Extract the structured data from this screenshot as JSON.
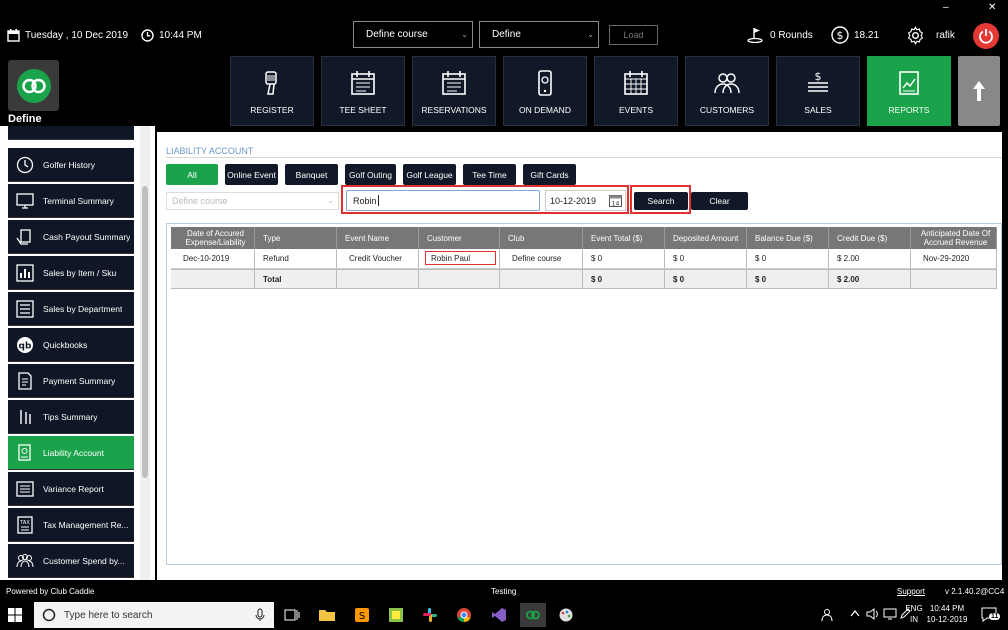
{
  "topbar": {
    "date": "Tuesday ,  10 Dec 2019",
    "time": "10:44 PM",
    "course_select": "Define  course",
    "define_select": "Define",
    "load_label": "Load",
    "rounds": "0 Rounds",
    "balance": "18.21",
    "user": "rafik",
    "minimize": "–",
    "close": "✕"
  },
  "brand": {
    "name": "Define"
  },
  "nav": [
    {
      "label": "REGISTER",
      "icon": "barcode-scanner-icon"
    },
    {
      "label": "TEE SHEET",
      "icon": "calendar-icon"
    },
    {
      "label": "RESERVATIONS",
      "icon": "calendar-icon"
    },
    {
      "label": "ON DEMAND",
      "icon": "mobile-icon"
    },
    {
      "label": "EVENTS",
      "icon": "calendar-grid-icon"
    },
    {
      "label": "CUSTOMERS",
      "icon": "users-icon"
    },
    {
      "label": "SALES",
      "icon": "money-icon"
    },
    {
      "label": "REPORTS",
      "icon": "report-icon"
    }
  ],
  "sidebar": {
    "items": [
      {
        "label": "Golfer History",
        "icon": "golfer-icon"
      },
      {
        "label": "Terminal Summary",
        "icon": "monitor-icon"
      },
      {
        "label": "Cash Payout Summary",
        "icon": "cash-icon"
      },
      {
        "label": "Sales by Item / Sku",
        "icon": "bar-chart-icon"
      },
      {
        "label": "Sales by Department",
        "icon": "list-icon"
      },
      {
        "label": "Quickbooks",
        "icon": "quickbooks-icon"
      },
      {
        "label": "Payment Summary",
        "icon": "document-icon"
      },
      {
        "label": "Tips Summary",
        "icon": "tips-icon"
      },
      {
        "label": "Liability Account",
        "icon": "liability-icon"
      },
      {
        "label": "Variance Report",
        "icon": "variance-icon"
      },
      {
        "label": "Tax Management Re...",
        "icon": "tax-icon"
      },
      {
        "label": "Customer Spend by...",
        "icon": "users-icon"
      }
    ]
  },
  "main": {
    "title": "LIABILITY ACCOUNT",
    "filters": [
      "All",
      "Online Event",
      "Banquet",
      "Golf Outing",
      "Golf League",
      "Tee Time",
      "Gift Cards"
    ],
    "course_placeholder": "Define  course",
    "search_value": "Robin",
    "date_value": "10-12-2019",
    "calendar_day": "14",
    "search_label": "Search",
    "clear_label": "Clear"
  },
  "table": {
    "headers": [
      "Date of Accured Expense/Liability",
      "Type",
      "Event Name",
      "Customer",
      "Club",
      "Event Total ($)",
      "Deposited Amount",
      "Balance Due ($)",
      "Credit Due ($)",
      "Anticipated Date Of Accrued Revenue"
    ],
    "rows": [
      [
        "Dec-10-2019",
        "Refund",
        "Credit Voucher",
        "Robin Paul",
        "Define  course",
        "$ 0",
        "$ 0",
        "$ 0",
        "$ 2.00",
        "Nov-29-2020"
      ]
    ],
    "total": [
      "",
      "Total",
      "",
      "",
      "",
      "$ 0",
      "$ 0",
      "$ 0",
      "$ 2.00",
      ""
    ]
  },
  "status": {
    "powered": "Powered by Club Caddie",
    "env": "Testing",
    "support": "Support",
    "version": "v 2.1.40.2@CC4"
  },
  "taskbar": {
    "search_placeholder": "Type here to search",
    "lang": "ENG",
    "region": "IN",
    "time": "10:44 PM",
    "date": "10-12-2019",
    "notif_count": "11"
  },
  "colors": {
    "accent_green": "#1aa34a",
    "dark_tile": "#111827",
    "highlight_red": "#e03030",
    "title_blue": "#6a97c8"
  }
}
